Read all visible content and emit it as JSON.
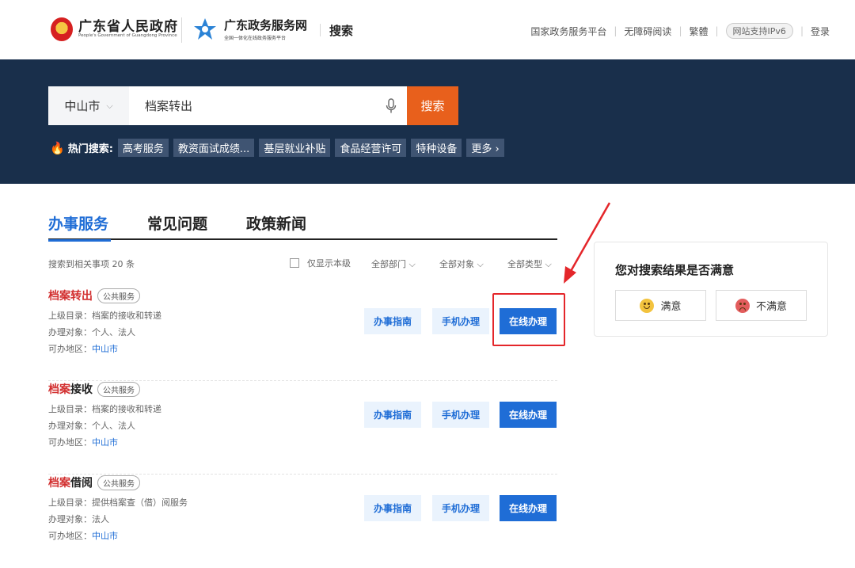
{
  "header": {
    "gov_title": "广东省人民政府",
    "gov_subtitle": "People's Government of Guangdong Province",
    "service_title": "广东政务服务网",
    "service_subtitle": "全国一体化在线政务服务平台",
    "section_label": "搜索",
    "links": [
      "国家政务服务平台",
      "无障碍阅读",
      "繁體"
    ],
    "ipv6_badge": "网站支持IPv6",
    "login": "登录"
  },
  "search": {
    "city": "中山市",
    "query": "档案转出",
    "button": "搜索",
    "hot_label": "热门搜索:",
    "hot_items": [
      "高考服务",
      "教资面试成绩...",
      "基层就业补贴",
      "食品经营许可",
      "特种设备"
    ],
    "more": "更多 ›"
  },
  "tabs": [
    "办事服务",
    "常见问题",
    "政策新闻"
  ],
  "filters": {
    "result_count": "搜索到相关事项 20 条",
    "local_only": "仅显示本级",
    "department": "全部部门",
    "target": "全部对象",
    "type": "全部类型"
  },
  "results": [
    {
      "title_hl": "档案转出",
      "title_rest": "",
      "tag": "公共服务",
      "parent": "上级目录：档案的接收和转递",
      "target": "办理对象：个人、法人",
      "region_label": "可办地区：",
      "region": "中山市",
      "guide": "办事指南",
      "mobile": "手机办理",
      "online": "在线办理"
    },
    {
      "title_hl": "档案",
      "title_rest": "接收",
      "tag": "公共服务",
      "parent": "上级目录：档案的接收和转递",
      "target": "办理对象：个人、法人",
      "region_label": "可办地区：",
      "region": "中山市",
      "guide": "办事指南",
      "mobile": "手机办理",
      "online": "在线办理"
    },
    {
      "title_hl": "档案",
      "title_rest": "借阅",
      "tag": "公共服务",
      "parent": "上级目录：提供档案查（借）阅服务",
      "target": "办理对象：法人",
      "region_label": "可办地区：",
      "region": "中山市",
      "guide": "办事指南",
      "mobile": "手机办理",
      "online": "在线办理"
    }
  ],
  "feedback": {
    "question": "您对搜索结果是否满意",
    "satisfied": "满意",
    "unsatisfied": "不满意"
  },
  "colors": {
    "accent_blue": "#1f6dd6",
    "search_orange": "#e8601c",
    "banner_navy": "#192f4b",
    "annotation_red": "#e4262a"
  }
}
